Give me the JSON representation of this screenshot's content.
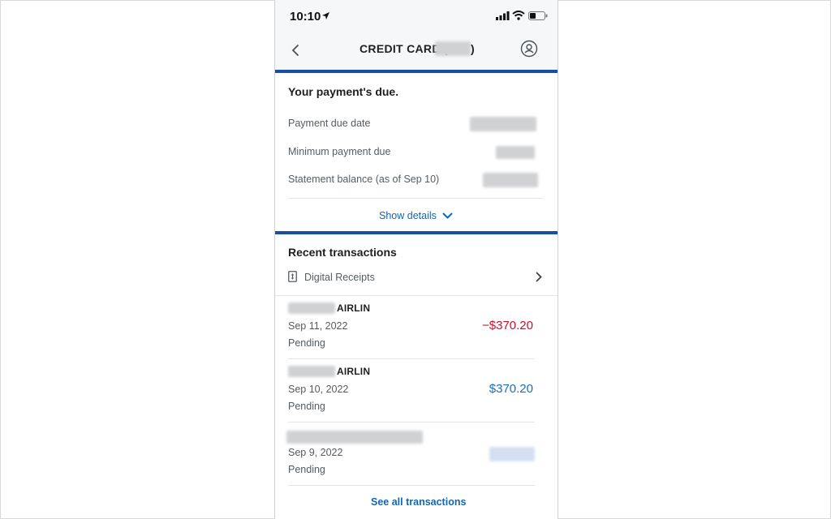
{
  "status_bar": {
    "time": "10:10"
  },
  "nav": {
    "title": "CREDIT CARD (.",
    "title_close": ")"
  },
  "payment": {
    "heading": "Your payment's due.",
    "rows": [
      {
        "label": "Payment due date"
      },
      {
        "label": "Minimum payment due"
      },
      {
        "label": "Statement balance (as of Sep 10)"
      }
    ],
    "show_details": "Show details"
  },
  "transactions": {
    "heading": "Recent transactions",
    "digital_receipts": "Digital Receipts",
    "items": [
      {
        "merchant": "AIRLIN",
        "date": "Sep 11, 2022",
        "status": "Pending",
        "amount": "−$370.20"
      },
      {
        "merchant": "AIRLIN",
        "date": "Sep 10, 2022",
        "status": "Pending",
        "amount": "$370.20"
      },
      {
        "merchant": "",
        "date": "Sep 9, 2022",
        "status": "Pending",
        "amount": ""
      }
    ],
    "see_all": "See all transactions"
  },
  "colors": {
    "accent_blue": "#1b4ea1",
    "link_blue": "#1266b8",
    "negative_red": "#c8102e",
    "credit_blue": "#1a6fb5"
  }
}
